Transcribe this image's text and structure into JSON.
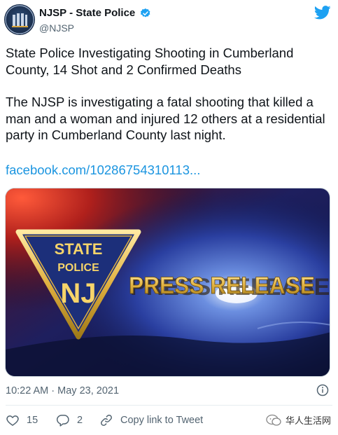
{
  "author": {
    "name": "NJSP - State Police",
    "handle": "@NJSP"
  },
  "tweet": {
    "headline": "State Police Investigating Shooting in Cumberland County, 14 Shot and 2 Confirmed Deaths",
    "body": "The NJSP is investigating a fatal shooting that killed a man and a woman and injured 12 others at a residential party in Cumberland County last night.",
    "link": "facebook.com/10286754310113..."
  },
  "media": {
    "badge_line1": "STATE",
    "badge_line2": "POLICE",
    "badge_line3": "NJ",
    "banner": "PRESS RELEASE"
  },
  "meta": {
    "timestamp": "10:22 AM · May 23, 2021"
  },
  "actions": {
    "likes": "15",
    "replies": "2",
    "copy_label": "Copy link to Tweet"
  },
  "watermark": {
    "text": "华人生活网"
  },
  "colors": {
    "link": "#1b95e0",
    "twitter_blue": "#1da1f2",
    "secondary_text": "#536471"
  }
}
